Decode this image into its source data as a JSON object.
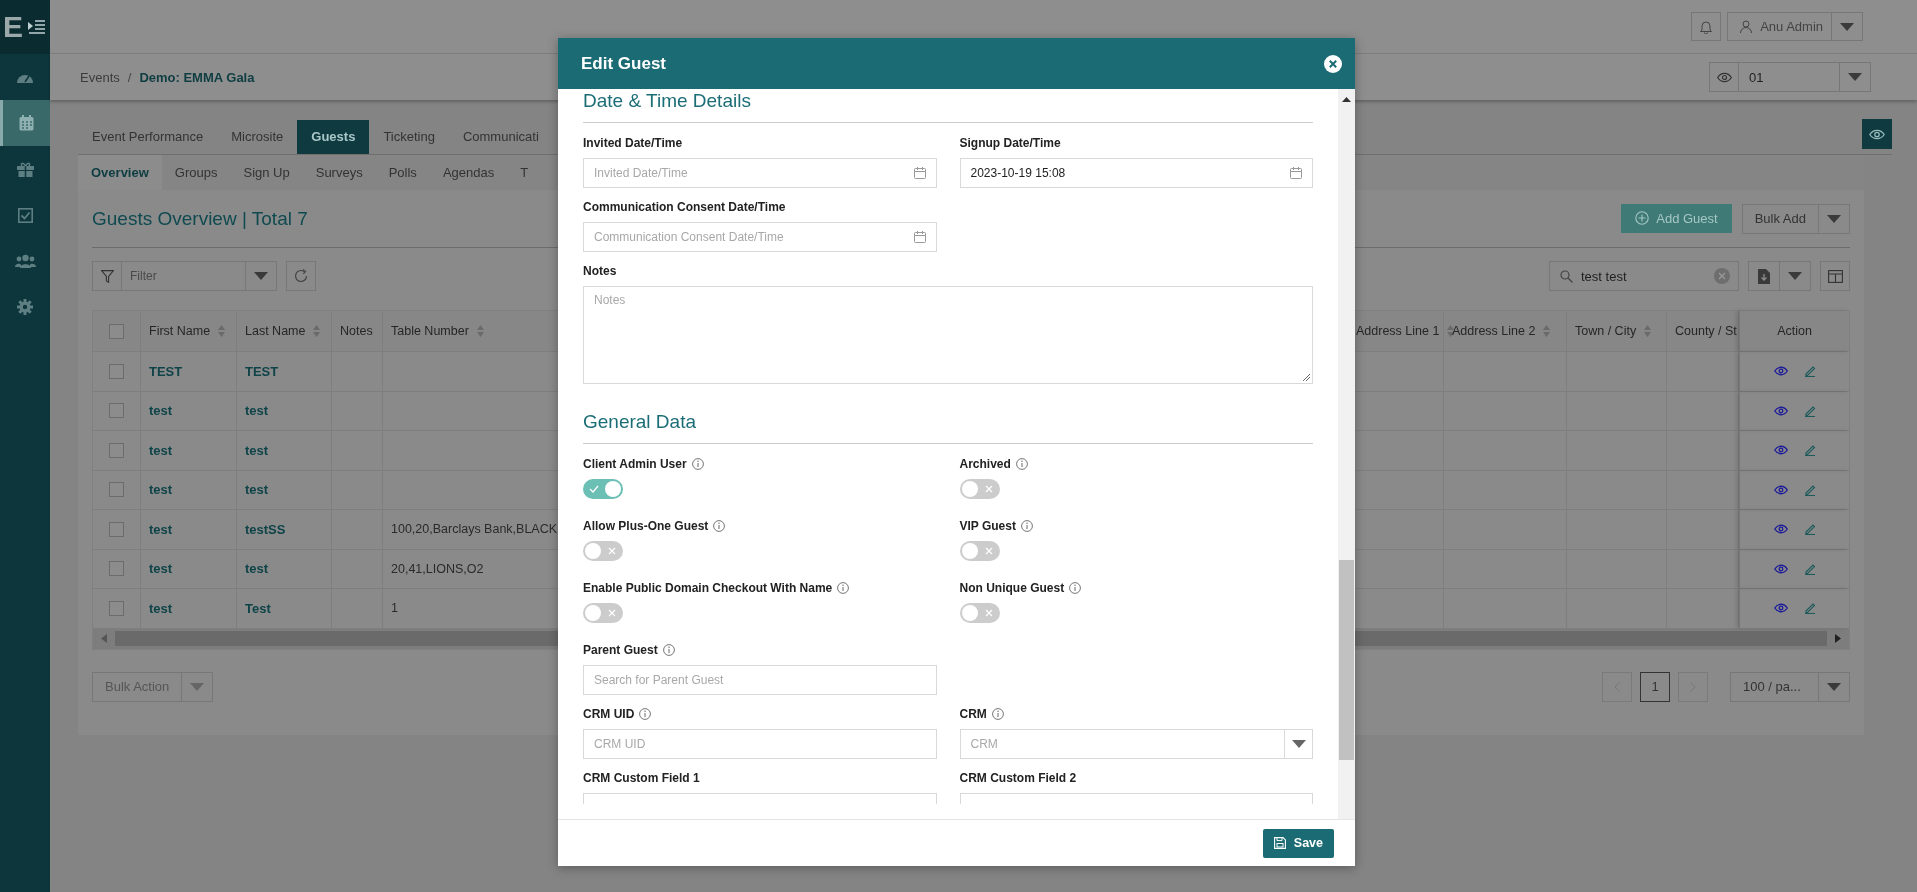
{
  "sidebar": {
    "logo": "E",
    "items": [
      {
        "kind": "dashboard",
        "selected": false
      },
      {
        "kind": "calendar",
        "selected": true
      },
      {
        "kind": "gift",
        "selected": false
      },
      {
        "kind": "checklist",
        "selected": false
      },
      {
        "kind": "people",
        "selected": false
      },
      {
        "kind": "settings",
        "selected": false
      }
    ]
  },
  "top_bar": {
    "user": "Anu Admin"
  },
  "breadcrumb": {
    "items": [
      "Events",
      "Demo: EMMA Gala"
    ],
    "separator": "/"
  },
  "event_selector": {
    "value": "01"
  },
  "tabs": [
    {
      "label": "Event Performance",
      "selected": false
    },
    {
      "label": "Microsite",
      "selected": false
    },
    {
      "label": "Guests",
      "selected": true
    },
    {
      "label": "Ticketing",
      "selected": false
    },
    {
      "label": "Communicati",
      "selected": false
    }
  ],
  "subtabs": [
    {
      "label": "Overview",
      "selected": true
    },
    {
      "label": "Groups",
      "selected": false
    },
    {
      "label": "Sign Up",
      "selected": false
    },
    {
      "label": "Surveys",
      "selected": false
    },
    {
      "label": "Polls",
      "selected": false
    },
    {
      "label": "Agendas",
      "selected": false
    },
    {
      "label": "T",
      "selected": false
    }
  ],
  "overview": {
    "title": "Guests Overview | Total 7",
    "add_button": "Add Guest",
    "bulk_add": "Bulk Add",
    "filter_placeholder": "Filter",
    "search_value": "test test"
  },
  "table": {
    "header_checked": false,
    "columns": [
      {
        "label": "First Name",
        "sortable": true
      },
      {
        "label": "Last Name",
        "sortable": true
      },
      {
        "label": "Notes"
      },
      {
        "label": "Table Number",
        "sortable": true
      },
      {
        "label": "Address Line 1",
        "sortable": true
      },
      {
        "label": "Address Line 2",
        "sortable": true
      },
      {
        "label": "Town / City",
        "sortable": true
      },
      {
        "label": "County / St"
      },
      {
        "label": "Action"
      }
    ],
    "rows": [
      {
        "checked": false,
        "first_name": "TEST",
        "last_name": "TEST"
      },
      {
        "checked": false,
        "first_name": "test",
        "last_name": "test"
      },
      {
        "checked": false,
        "first_name": "test",
        "last_name": "test"
      },
      {
        "checked": false,
        "first_name": "test",
        "last_name": "test"
      },
      {
        "checked": false,
        "first_name": "test",
        "last_name": "testSS",
        "table_number": "100,20,Barclays Bank,BLACK"
      },
      {
        "checked": false,
        "first_name": "test",
        "last_name": "test",
        "table_number": "20,41,LIONS,O2"
      },
      {
        "checked": false,
        "first_name": "test",
        "last_name": "Test",
        "table_number": "1"
      }
    ]
  },
  "bulk_action": "Bulk Action",
  "pagination": {
    "pages": [
      {
        "label": "1",
        "selected": true
      }
    ],
    "page_size": "100 / pa..."
  },
  "modal": {
    "title": "Edit Guest",
    "save": "Save",
    "sections": [
      {
        "title": "Date & Time Details",
        "rows": [
          [
            {
              "kind": "date",
              "label": "Invited Date/Time",
              "placeholder": "Invited Date/Time"
            },
            {
              "kind": "date",
              "label": "Signup Date/Time",
              "value": "2023-10-19 15:08"
            }
          ],
          [
            {
              "kind": "date",
              "label": "Communication Consent Date/Time",
              "placeholder": "Communication Consent Date/Time"
            }
          ],
          [
            {
              "kind": "textarea",
              "label": "Notes",
              "placeholder": "Notes"
            }
          ]
        ]
      },
      {
        "title": "General Data",
        "rows": [
          [
            {
              "kind": "toggle",
              "label": "Client Admin User",
              "info": true,
              "on": true
            },
            {
              "kind": "toggle",
              "label": "Archived",
              "info": true,
              "on": false
            }
          ],
          [
            {
              "kind": "toggle",
              "label": "Allow Plus-One Guest",
              "info": true,
              "on": false
            },
            {
              "kind": "toggle",
              "label": "VIP Guest",
              "info": true,
              "on": false
            }
          ],
          [
            {
              "kind": "toggle",
              "label": "Enable Public Domain Checkout With Name",
              "info": true,
              "on": false
            },
            {
              "kind": "toggle",
              "label": "Non Unique Guest",
              "info": true,
              "on": false
            }
          ],
          [
            {
              "kind": "text",
              "label": "Parent Guest",
              "info": true,
              "placeholder": "Search for Parent Guest"
            }
          ],
          [
            {
              "kind": "text",
              "label": "CRM UID",
              "info": true,
              "placeholder": "CRM UID"
            },
            {
              "kind": "select",
              "label": "CRM",
              "info": true,
              "placeholder": "CRM"
            }
          ],
          [
            {
              "kind": "cut",
              "label": "CRM Custom Field 1"
            },
            {
              "kind": "cut",
              "label": "CRM Custom Field 2"
            }
          ]
        ]
      }
    ]
  }
}
